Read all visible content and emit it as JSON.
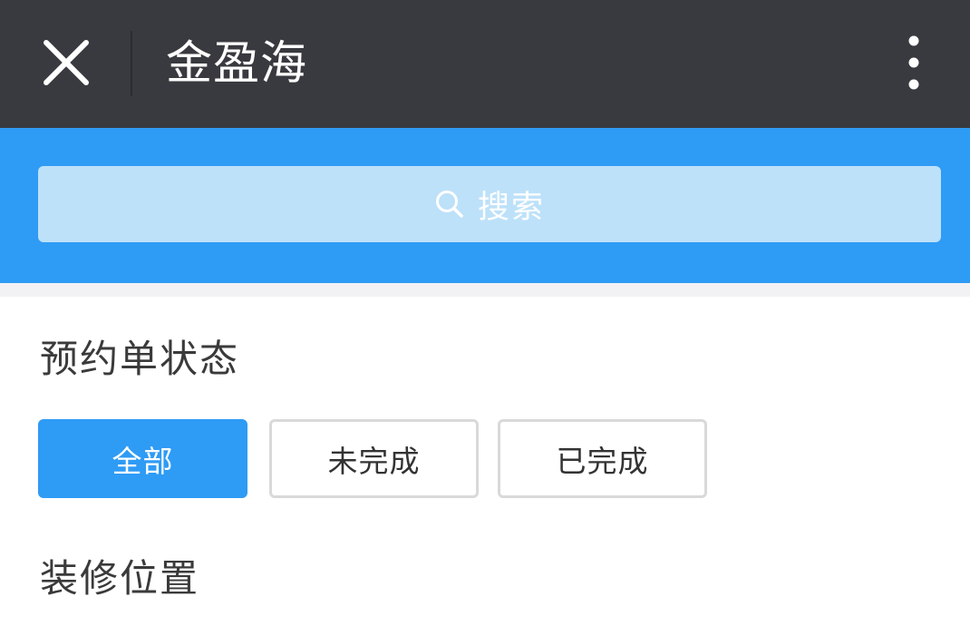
{
  "titlebar": {
    "title": "金盈海",
    "close_icon": "close-icon",
    "more_icon": "more-vertical-icon",
    "background_color": "#393a3f"
  },
  "search": {
    "placeholder": "搜索",
    "icon": "search-icon",
    "band_color": "#2e9bf5",
    "box_color": "#bde1f9"
  },
  "filters": {
    "status_title": "预约单状态",
    "status_options": [
      {
        "label": "全部",
        "selected": true
      },
      {
        "label": "未完成",
        "selected": false
      },
      {
        "label": "已完成",
        "selected": false
      }
    ],
    "location_title": "装修位置"
  },
  "colors": {
    "accent": "#2e9bf5",
    "chip_border": "#d9d9d9",
    "section_text": "#3a3a3a"
  }
}
